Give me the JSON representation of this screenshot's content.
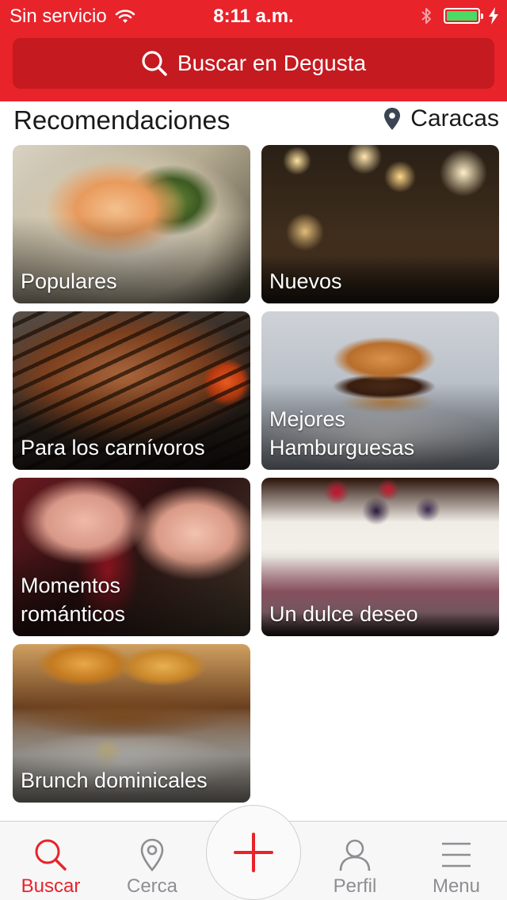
{
  "status": {
    "carrier": "Sin servicio",
    "time": "8:11 a.m."
  },
  "search": {
    "label": "Buscar en Degusta"
  },
  "section": {
    "title": "Recomendaciones",
    "location": "Caracas"
  },
  "tiles": [
    {
      "label": "Populares"
    },
    {
      "label": "Nuevos"
    },
    {
      "label": "Para los carnívoros"
    },
    {
      "label": "Mejores\nHamburguesas"
    },
    {
      "label": "Momentos\nrománticos"
    },
    {
      "label": "Un dulce deseo"
    },
    {
      "label": "Brunch dominicales"
    }
  ],
  "tabbar": {
    "tabs": [
      {
        "label": "Buscar",
        "icon": "search-icon",
        "active": true
      },
      {
        "label": "Cerca",
        "icon": "location-pin-icon"
      },
      {
        "label": "",
        "icon": "plus-icon"
      },
      {
        "label": "Perfil",
        "icon": "person-icon"
      },
      {
        "label": "Menu",
        "icon": "hamburger-menu-icon"
      }
    ]
  },
  "colors": {
    "brand_red": "#e8232a",
    "search_bg": "#c41a20",
    "battery_green": "#4cd964",
    "tab_inactive": "#8e8e93"
  }
}
